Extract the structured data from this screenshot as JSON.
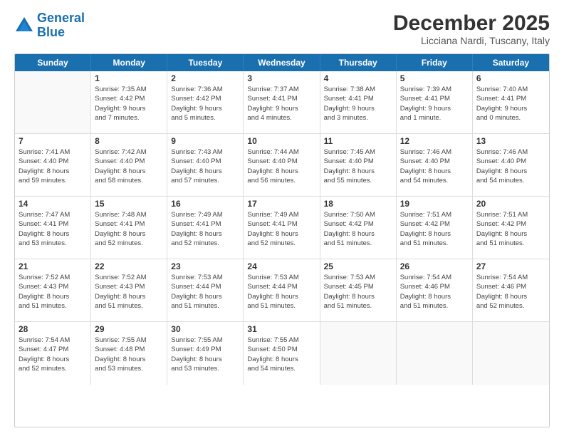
{
  "logo": {
    "line1": "General",
    "line2": "Blue"
  },
  "header": {
    "month": "December 2025",
    "location": "Licciana Nardi, Tuscany, Italy"
  },
  "weekdays": [
    "Sunday",
    "Monday",
    "Tuesday",
    "Wednesday",
    "Thursday",
    "Friday",
    "Saturday"
  ],
  "rows": [
    [
      {
        "day": "",
        "info": ""
      },
      {
        "day": "1",
        "info": "Sunrise: 7:35 AM\nSunset: 4:42 PM\nDaylight: 9 hours\nand 7 minutes."
      },
      {
        "day": "2",
        "info": "Sunrise: 7:36 AM\nSunset: 4:42 PM\nDaylight: 9 hours\nand 5 minutes."
      },
      {
        "day": "3",
        "info": "Sunrise: 7:37 AM\nSunset: 4:41 PM\nDaylight: 9 hours\nand 4 minutes."
      },
      {
        "day": "4",
        "info": "Sunrise: 7:38 AM\nSunset: 4:41 PM\nDaylight: 9 hours\nand 3 minutes."
      },
      {
        "day": "5",
        "info": "Sunrise: 7:39 AM\nSunset: 4:41 PM\nDaylight: 9 hours\nand 1 minute."
      },
      {
        "day": "6",
        "info": "Sunrise: 7:40 AM\nSunset: 4:41 PM\nDaylight: 9 hours\nand 0 minutes."
      }
    ],
    [
      {
        "day": "7",
        "info": "Sunrise: 7:41 AM\nSunset: 4:40 PM\nDaylight: 8 hours\nand 59 minutes."
      },
      {
        "day": "8",
        "info": "Sunrise: 7:42 AM\nSunset: 4:40 PM\nDaylight: 8 hours\nand 58 minutes."
      },
      {
        "day": "9",
        "info": "Sunrise: 7:43 AM\nSunset: 4:40 PM\nDaylight: 8 hours\nand 57 minutes."
      },
      {
        "day": "10",
        "info": "Sunrise: 7:44 AM\nSunset: 4:40 PM\nDaylight: 8 hours\nand 56 minutes."
      },
      {
        "day": "11",
        "info": "Sunrise: 7:45 AM\nSunset: 4:40 PM\nDaylight: 8 hours\nand 55 minutes."
      },
      {
        "day": "12",
        "info": "Sunrise: 7:46 AM\nSunset: 4:40 PM\nDaylight: 8 hours\nand 54 minutes."
      },
      {
        "day": "13",
        "info": "Sunrise: 7:46 AM\nSunset: 4:40 PM\nDaylight: 8 hours\nand 54 minutes."
      }
    ],
    [
      {
        "day": "14",
        "info": "Sunrise: 7:47 AM\nSunset: 4:41 PM\nDaylight: 8 hours\nand 53 minutes."
      },
      {
        "day": "15",
        "info": "Sunrise: 7:48 AM\nSunset: 4:41 PM\nDaylight: 8 hours\nand 52 minutes."
      },
      {
        "day": "16",
        "info": "Sunrise: 7:49 AM\nSunset: 4:41 PM\nDaylight: 8 hours\nand 52 minutes."
      },
      {
        "day": "17",
        "info": "Sunrise: 7:49 AM\nSunset: 4:41 PM\nDaylight: 8 hours\nand 52 minutes."
      },
      {
        "day": "18",
        "info": "Sunrise: 7:50 AM\nSunset: 4:42 PM\nDaylight: 8 hours\nand 51 minutes."
      },
      {
        "day": "19",
        "info": "Sunrise: 7:51 AM\nSunset: 4:42 PM\nDaylight: 8 hours\nand 51 minutes."
      },
      {
        "day": "20",
        "info": "Sunrise: 7:51 AM\nSunset: 4:42 PM\nDaylight: 8 hours\nand 51 minutes."
      }
    ],
    [
      {
        "day": "21",
        "info": "Sunrise: 7:52 AM\nSunset: 4:43 PM\nDaylight: 8 hours\nand 51 minutes."
      },
      {
        "day": "22",
        "info": "Sunrise: 7:52 AM\nSunset: 4:43 PM\nDaylight: 8 hours\nand 51 minutes."
      },
      {
        "day": "23",
        "info": "Sunrise: 7:53 AM\nSunset: 4:44 PM\nDaylight: 8 hours\nand 51 minutes."
      },
      {
        "day": "24",
        "info": "Sunrise: 7:53 AM\nSunset: 4:44 PM\nDaylight: 8 hours\nand 51 minutes."
      },
      {
        "day": "25",
        "info": "Sunrise: 7:53 AM\nSunset: 4:45 PM\nDaylight: 8 hours\nand 51 minutes."
      },
      {
        "day": "26",
        "info": "Sunrise: 7:54 AM\nSunset: 4:46 PM\nDaylight: 8 hours\nand 51 minutes."
      },
      {
        "day": "27",
        "info": "Sunrise: 7:54 AM\nSunset: 4:46 PM\nDaylight: 8 hours\nand 52 minutes."
      }
    ],
    [
      {
        "day": "28",
        "info": "Sunrise: 7:54 AM\nSunset: 4:47 PM\nDaylight: 8 hours\nand 52 minutes."
      },
      {
        "day": "29",
        "info": "Sunrise: 7:55 AM\nSunset: 4:48 PM\nDaylight: 8 hours\nand 53 minutes."
      },
      {
        "day": "30",
        "info": "Sunrise: 7:55 AM\nSunset: 4:49 PM\nDaylight: 8 hours\nand 53 minutes."
      },
      {
        "day": "31",
        "info": "Sunrise: 7:55 AM\nSunset: 4:50 PM\nDaylight: 8 hours\nand 54 minutes."
      },
      {
        "day": "",
        "info": ""
      },
      {
        "day": "",
        "info": ""
      },
      {
        "day": "",
        "info": ""
      }
    ]
  ]
}
